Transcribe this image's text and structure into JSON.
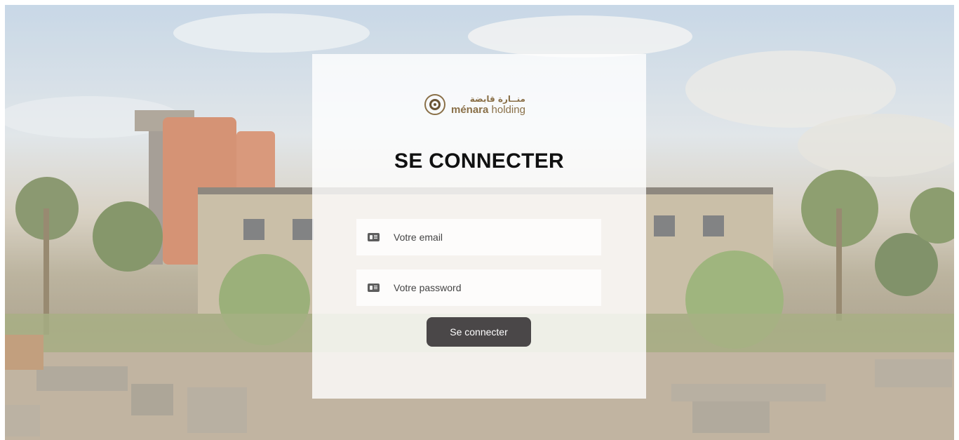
{
  "logo": {
    "arabic": "منــارة قابضة",
    "name_bold": "ménara",
    "name_rest": " holding"
  },
  "login": {
    "title": "SE CONNECTER",
    "email_placeholder": "Votre email",
    "password_placeholder": "Votre password",
    "submit_label": "Se connecter"
  },
  "colors": {
    "button": "#4a4748",
    "brand": "#8a7048"
  },
  "icons": {
    "email": "id-card-icon",
    "password": "id-card-icon"
  }
}
